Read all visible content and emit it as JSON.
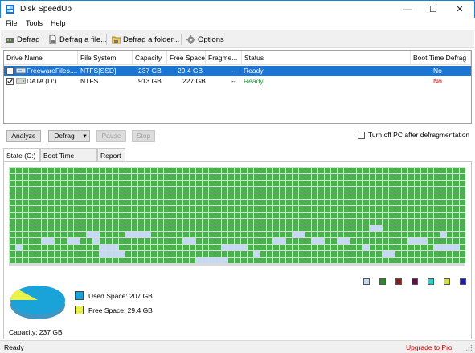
{
  "window": {
    "title": "Disk SpeedUp",
    "controls": {
      "minimize": "—",
      "maximize": "☐",
      "close": "✕"
    }
  },
  "menu": [
    "File",
    "Tools",
    "Help"
  ],
  "toolbar": {
    "defrag": "Defrag",
    "defrag_file": "Defrag a file...",
    "defrag_folder": "Defrag a folder...",
    "options": "Options"
  },
  "drives": {
    "columns": [
      "Drive Name",
      "File System",
      "Capacity",
      "Free Space",
      "Fragme...",
      "Status",
      "Boot Time Defrag"
    ],
    "rows": [
      {
        "checked": false,
        "name": "FreewareFiles....",
        "fs": "NTFS[SSD]",
        "capacity": "237 GB",
        "free": "29.4 GB",
        "frag": "--",
        "status": "Ready",
        "boot": "No",
        "selected": true
      },
      {
        "checked": true,
        "name": "DATA (D:)",
        "fs": "NTFS",
        "capacity": "913 GB",
        "free": "227 GB",
        "frag": "--",
        "status": "Ready",
        "boot": "No",
        "selected": false
      }
    ]
  },
  "controls": {
    "analyze": "Analyze",
    "defrag": "Defrag",
    "dropdown": "▾",
    "pause": "Pause",
    "stop": "Stop",
    "turn_off": "Turn off PC after defragmentation"
  },
  "tabs": [
    "State (C:)",
    "Boot Time Defrag",
    "Report"
  ],
  "map": {
    "colors": {
      "used": "#4caf50",
      "free": "#c5daf0",
      "empty": "#ffffff"
    }
  },
  "legend": {
    "used": "Used Space: 207 GB",
    "free": "Free Space: 29.4 GB",
    "capacity": "Capacity: 237 GB",
    "colors": {
      "used": "#1aa3d9",
      "free": "#e8f24a"
    },
    "swatches": [
      "#c5daf0",
      "#2a8a2a",
      "#8b1a1a",
      "#6a0a4a",
      "#26d0cc",
      "#d4e038",
      "#1a1ab4"
    ]
  },
  "statusbar": {
    "status": "Ready",
    "upgrade": "Upgrade to Pro"
  }
}
